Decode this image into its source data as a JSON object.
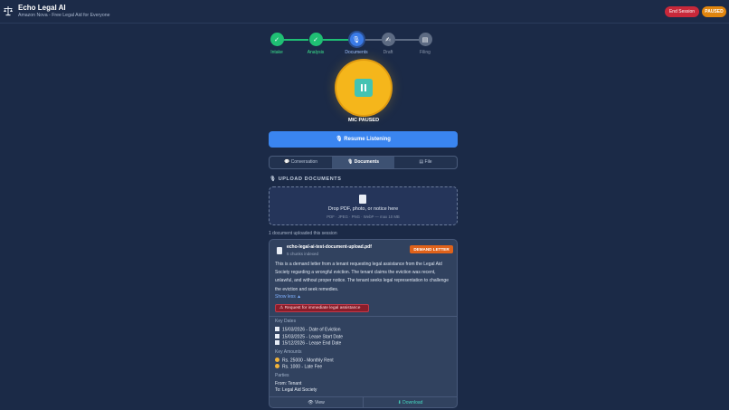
{
  "header": {
    "title": "Echo Legal AI",
    "subtitle": "Amazon Nova - Free Legal Aid for Everyone",
    "end_session": "End Session",
    "status": "PAUSED"
  },
  "stepper": [
    {
      "label": "Intake",
      "state": "done"
    },
    {
      "label": "Analysis",
      "state": "done"
    },
    {
      "label": "Documents",
      "state": "active"
    },
    {
      "label": "Draft",
      "state": "todo"
    },
    {
      "label": "Filing",
      "state": "todo"
    }
  ],
  "mic": {
    "status": "MIC PAUSED"
  },
  "resume_button": "Resume Listening",
  "tabs": [
    {
      "label": "Conversation",
      "icon": "chat-icon",
      "selected": false
    },
    {
      "label": "Documents",
      "icon": "document-icon",
      "selected": true
    },
    {
      "label": "File",
      "icon": "file-icon",
      "selected": false
    }
  ],
  "upload": {
    "section_title": "UPLOAD DOCUMENTS",
    "drop_title": "Drop PDF, photo, or notice here",
    "drop_sub": "PDF · JPEG · PNG · WebP — max 10 MB",
    "count_text": "1 document uploaded this session"
  },
  "document": {
    "file_name": "echo-legal-ai-test-document-upload.pdf",
    "chunks": "5 chunks indexed",
    "type_badge": "DEMAND LETTER",
    "summary": "This is a demand letter from a tenant requesting legal assistance from the Legal Aid Society regarding a wrongful eviction. The tenant claims the eviction was recent, unlawful, and without proper notice. The tenant seeks legal representation to challenge the eviction and seek remedies.",
    "show_less": "Show less ▲",
    "urgent": "Request for immediate legal assistance",
    "key_dates_title": "Key Dates",
    "key_dates": [
      "15/03/2026 - Date of Eviction",
      "15/03/2025 - Lease Start Date",
      "15/12/2026 - Lease End Date"
    ],
    "key_amounts_title": "Key Amounts",
    "key_amounts": [
      "Rs. 25000 - Monthly Rent",
      "Rs. 1000 - Late Fee"
    ],
    "parties_title": "Parties",
    "parties": [
      "From: Tenant",
      "To: Legal Aid Society"
    ],
    "view_label": "View",
    "download_label": "Download"
  }
}
